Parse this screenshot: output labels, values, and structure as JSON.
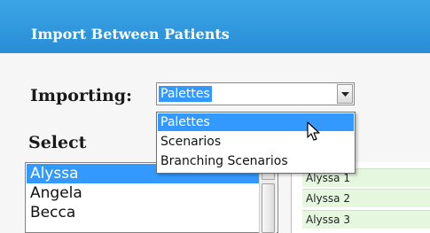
{
  "window": {
    "title": "Import Between Patients"
  },
  "importing": {
    "label": "Importing:",
    "selected": "Palettes",
    "options": [
      {
        "label": "Palettes",
        "selected": true
      },
      {
        "label": "Scenarios",
        "selected": false
      },
      {
        "label": "Branching Scenarios",
        "selected": false
      }
    ]
  },
  "select": {
    "label": "Select",
    "patients": [
      {
        "label": "Alyssa",
        "selected": true
      },
      {
        "label": "Angela",
        "selected": false
      },
      {
        "label": "Becca",
        "selected": false
      }
    ]
  },
  "right_list": {
    "items": [
      {
        "label": "Alyssa 1"
      },
      {
        "label": "Alyssa 2"
      },
      {
        "label": "Alyssa 3"
      }
    ]
  },
  "colors": {
    "titlebar": "#2a8dd6",
    "selection": "#3399ff",
    "row_green": "#e6f7e0"
  }
}
